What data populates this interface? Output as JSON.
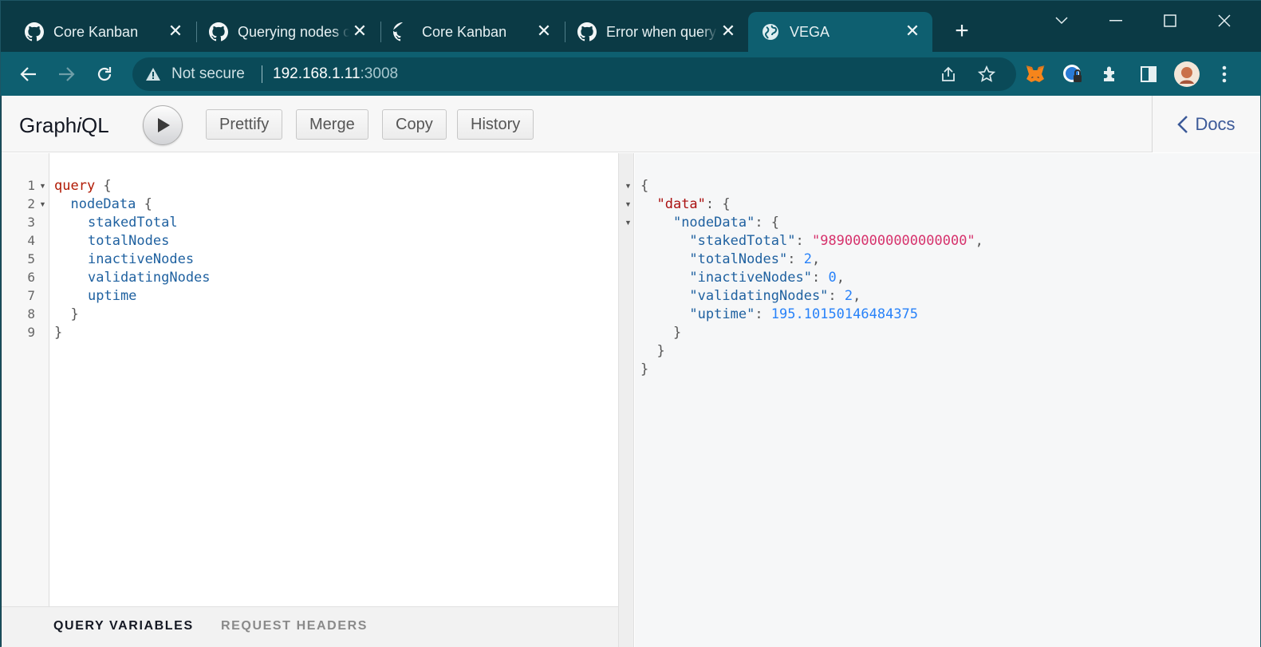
{
  "tabs": [
    {
      "title": "Core Kanban",
      "icon": "github-icon"
    },
    {
      "title": "Querying nodes o",
      "icon": "github-icon"
    },
    {
      "title": "Core Kanban",
      "icon": "github-icon"
    },
    {
      "title": "Error when query",
      "icon": "github-icon"
    },
    {
      "title": "VEGA",
      "icon": "globe-icon",
      "active": true
    }
  ],
  "addressbar": {
    "security": "Not secure",
    "host": "192.168.1.11",
    "port": ":3008"
  },
  "graphiql": {
    "logo_pre": "Graph",
    "logo_i": "i",
    "logo_post": "QL",
    "buttons": {
      "prettify": "Prettify",
      "merge": "Merge",
      "copy": "Copy",
      "history": "History"
    },
    "docs": "Docs",
    "query_lines": [
      {
        "n": "1",
        "text": "query {"
      },
      {
        "n": "2",
        "text": "  nodeData {"
      },
      {
        "n": "3",
        "text": "    stakedTotal"
      },
      {
        "n": "4",
        "text": "    totalNodes"
      },
      {
        "n": "5",
        "text": "    inactiveNodes"
      },
      {
        "n": "6",
        "text": "    validatingNodes"
      },
      {
        "n": "7",
        "text": "    uptime"
      },
      {
        "n": "8",
        "text": "  }"
      },
      {
        "n": "9",
        "text": "}"
      }
    ],
    "query_keyword": "query",
    "query_root": "nodeData",
    "fields": [
      "stakedTotal",
      "totalNodes",
      "inactiveNodes",
      "validatingNodes",
      "uptime"
    ],
    "bottom_tabs": {
      "variables": "QUERY VARIABLES",
      "headers": "REQUEST HEADERS"
    },
    "result": {
      "data_key": "\"data\"",
      "nodeData_key": "\"nodeData\"",
      "stakedTotal": "\"989000000000000000\"",
      "totalNodes": "2",
      "inactiveNodes": "0",
      "validatingNodes": "2",
      "uptime": "195.10150146484375"
    }
  },
  "colors": {
    "chrome_dark": "#0b3a45",
    "chrome_bar": "#0e5f70",
    "keyword": "#b11a04",
    "field": "#1f61a0",
    "string": "#d6326c",
    "number": "#2882f9"
  }
}
